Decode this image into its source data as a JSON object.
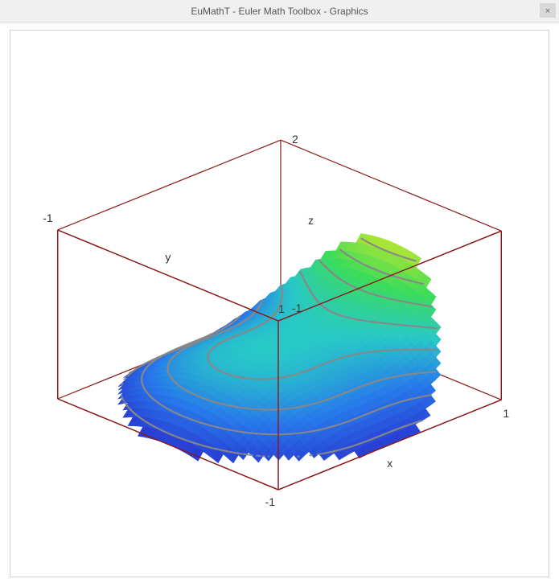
{
  "app": {
    "title": "EuMathT - Euler Math Toolbox - Graphics",
    "close_label": "×"
  },
  "chart_data": {
    "type": "surface3d",
    "title": "",
    "function": "x^3 - y^2",
    "axes": {
      "x_label": "x",
      "y_label": "y",
      "z_label": "z"
    },
    "xrange": [
      -1,
      1
    ],
    "yrange": [
      -1,
      1
    ],
    "zrange": [
      -1,
      2
    ],
    "x_ticks": [
      -1,
      1
    ],
    "y_ticks": [
      -1,
      1
    ],
    "z_ticks": [
      -1,
      2
    ],
    "contours": {
      "enabled": true,
      "spacing": 0.25
    },
    "colormap": "spectral",
    "box_color": "#8a1818",
    "tick_labels": {
      "x_minus1": "-1",
      "x_plus1": "1",
      "y_minus1": "-1",
      "y_plus1": "1",
      "z_minus1": "-1",
      "z_plus2": "2"
    },
    "axis_labels": {
      "x": "x",
      "y": "y",
      "z": "z"
    }
  }
}
